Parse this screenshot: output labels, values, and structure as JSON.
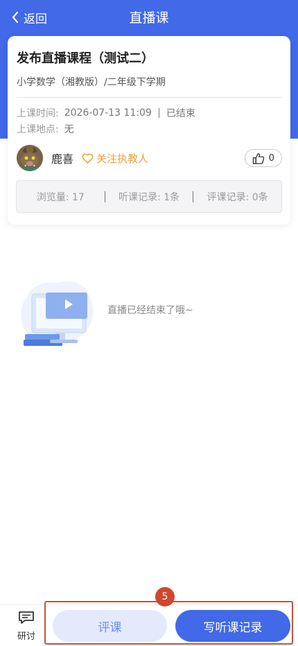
{
  "header": {
    "back_label": "返回",
    "title": "直播课"
  },
  "course": {
    "title": "发布直播课程（测试二）",
    "subject": "小学数学（湘教版）/二年级下学期",
    "time_label": "上课时间:",
    "time_value": "2026-07-13 11:09",
    "status": "已结束",
    "location_label": "上课地点:",
    "location_value": "无"
  },
  "teacher": {
    "name": "鹿喜",
    "follow_label": "关注执教人",
    "likes": "0"
  },
  "stats": {
    "views": "浏览量: 17",
    "listen_records": "听课记录: 1条",
    "review_records": "评课记录: 0条"
  },
  "empty": {
    "message": "直播已经结束了哦~"
  },
  "bottom": {
    "discuss_label": "研讨",
    "review_button": "评课",
    "record_button": "写听课记录",
    "marker_number": "5"
  },
  "colors": {
    "primary": "#4169e8",
    "follow": "#e8a33c",
    "marker": "#d0462e"
  }
}
